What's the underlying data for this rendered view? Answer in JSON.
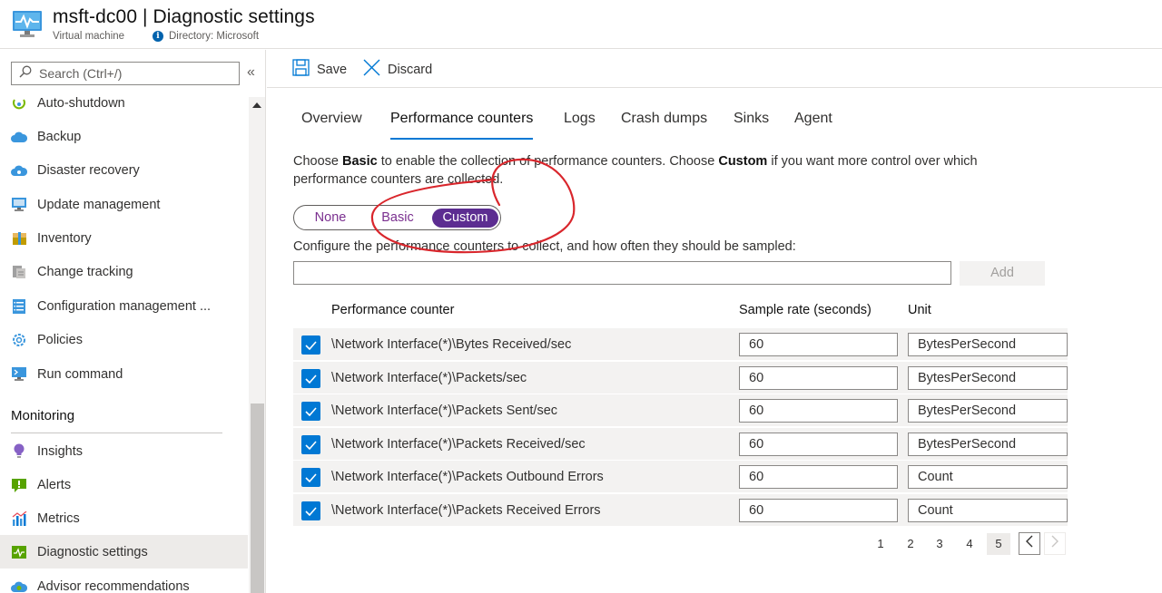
{
  "header": {
    "title": "msft-dc00 | Diagnostic settings",
    "resource_type": "Virtual machine",
    "directory": "Directory: Microsoft"
  },
  "sidebar": {
    "search_placeholder": "Search (Ctrl+/)",
    "collapse_glyph": "«",
    "items": [
      {
        "label": "Auto-shutdown",
        "icon": "clock-icon"
      },
      {
        "label": "Backup",
        "icon": "cloud-icon"
      },
      {
        "label": "Disaster recovery",
        "icon": "cloud-icon"
      },
      {
        "label": "Update management",
        "icon": "monitor-icon"
      },
      {
        "label": "Inventory",
        "icon": "box-icon"
      },
      {
        "label": "Change tracking",
        "icon": "document-icon"
      },
      {
        "label": "Configuration management ...",
        "icon": "checklist-icon"
      },
      {
        "label": "Policies",
        "icon": "gear-icon"
      },
      {
        "label": "Run command",
        "icon": "terminal-icon"
      }
    ],
    "section_monitoring": "Monitoring",
    "monitoring_items": [
      {
        "label": "Insights",
        "icon": "lightbulb-icon"
      },
      {
        "label": "Alerts",
        "icon": "alert-icon"
      },
      {
        "label": "Metrics",
        "icon": "bar-chart-icon"
      },
      {
        "label": "Diagnostic settings",
        "icon": "diagnostic-icon",
        "active": true
      },
      {
        "label": "Advisor recommendations",
        "icon": "cloud-icon"
      }
    ]
  },
  "toolbar": {
    "save_label": "Save",
    "discard_label": "Discard"
  },
  "tabs": [
    {
      "label": "Overview"
    },
    {
      "label": "Performance counters",
      "active": true
    },
    {
      "label": "Logs"
    },
    {
      "label": "Crash dumps"
    },
    {
      "label": "Sinks"
    },
    {
      "label": "Agent"
    }
  ],
  "description": {
    "p1": "Choose ",
    "basic": "Basic",
    "p2": " to enable the collection of performance counters. Choose ",
    "custom": "Custom",
    "p3": " if you want more control over which performance counters are collected."
  },
  "toggle": {
    "options": [
      "None",
      "Basic",
      "Custom"
    ],
    "selected": "Custom"
  },
  "configure": {
    "label": "Configure the performance counters to collect, and how often they should be sampled:",
    "input_value": "",
    "add_label": "Add"
  },
  "table": {
    "columns": [
      "Performance counter",
      "Sample rate (seconds)",
      "Unit"
    ],
    "rows": [
      {
        "counter": "\\Network Interface(*)\\Bytes Received/sec",
        "rate": "60",
        "unit": "BytesPerSecond",
        "checked": true
      },
      {
        "counter": "\\Network Interface(*)\\Packets/sec",
        "rate": "60",
        "unit": "BytesPerSecond",
        "checked": true
      },
      {
        "counter": "\\Network Interface(*)\\Packets Sent/sec",
        "rate": "60",
        "unit": "BytesPerSecond",
        "checked": true
      },
      {
        "counter": "\\Network Interface(*)\\Packets Received/sec",
        "rate": "60",
        "unit": "BytesPerSecond",
        "checked": true
      },
      {
        "counter": "\\Network Interface(*)\\Packets Outbound Errors",
        "rate": "60",
        "unit": "Count",
        "checked": true
      },
      {
        "counter": "\\Network Interface(*)\\Packets Received Errors",
        "rate": "60",
        "unit": "Count",
        "checked": true
      }
    ]
  },
  "pagination": {
    "pages": [
      "1",
      "2",
      "3",
      "4",
      "5"
    ],
    "current": "5"
  },
  "colors": {
    "accent": "#0078d4",
    "toggle_selected": "#5c2d91",
    "annotation": "#d9262c"
  }
}
